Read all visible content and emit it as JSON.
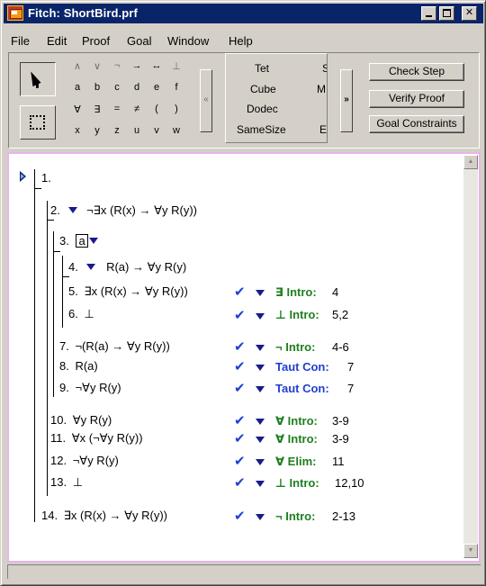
{
  "window": {
    "title": "Fitch: ShortBird.prf"
  },
  "menu": [
    "File",
    "Edit",
    "Proof",
    "Goal",
    "Window",
    "Help"
  ],
  "toolbar": {
    "symbols": [
      [
        "∧",
        "∨",
        "¬",
        "→",
        "↔",
        "⊥"
      ],
      [
        "a",
        "b",
        "c",
        "d",
        "e",
        "f"
      ],
      [
        "∀",
        "∃",
        "=",
        "≠",
        "(",
        ")"
      ],
      [
        "x",
        "y",
        "z",
        "u",
        "v",
        "w"
      ]
    ],
    "scroll_left": "«",
    "scroll_right": "»",
    "predicates": [
      "Tet",
      "Cube",
      "Dodec",
      "SameSize"
    ],
    "predicates_clipped": [
      "S",
      "M",
      "",
      "E"
    ],
    "buttons": {
      "check_step": "Check Step",
      "verify_proof": "Verify Proof",
      "goal_constraints": "Goal Constraints"
    }
  },
  "proof": {
    "lines": [
      {
        "n": "1.",
        "formula": ""
      },
      {
        "n": "2.",
        "formula": "¬∃x (R(x) → ∀y R(y))"
      },
      {
        "n": "3.",
        "formula": "",
        "boxed_constant": "a"
      },
      {
        "n": "4.",
        "formula": "R(a) → ∀y R(y)"
      },
      {
        "n": "5.",
        "formula": "∃x (R(x) → ∀y R(y))",
        "rule": "∃ Intro:",
        "cite": "4"
      },
      {
        "n": "6.",
        "formula": "⊥",
        "rule": "⊥ Intro:",
        "cite": "5,2"
      },
      {
        "n": "7.",
        "formula": "¬(R(a) → ∀y R(y))",
        "rule": "¬ Intro:",
        "cite": "4-6"
      },
      {
        "n": "8.",
        "formula": "R(a)",
        "rule": "Taut Con:",
        "cite": "7"
      },
      {
        "n": "9.",
        "formula": "¬∀y R(y)",
        "rule": "Taut Con:",
        "cite": "7"
      },
      {
        "n": "10.",
        "formula": "∀y R(y)",
        "rule": "∀ Intro:",
        "cite": "3-9"
      },
      {
        "n": "11.",
        "formula": "∀x (¬∀y R(y))",
        "rule": "∀ Intro:",
        "cite": "3-9"
      },
      {
        "n": "12.",
        "formula": "¬∀y R(y)",
        "rule": "∀ Elim:",
        "cite": "11"
      },
      {
        "n": "13.",
        "formula": "⊥",
        "rule": "⊥ Intro:",
        "cite": "12,10"
      },
      {
        "n": "14.",
        "formula": "∃x (R(x) → ∀y R(y))",
        "rule": "¬ Intro:",
        "cite": "2-13"
      }
    ],
    "check_glyph": "✔"
  },
  "colors": {
    "titlebar": "#0a246a",
    "rule_green": "#1f7f1f",
    "rule_blue": "#1f3fd1",
    "pane_border": "#e8b4e8"
  }
}
